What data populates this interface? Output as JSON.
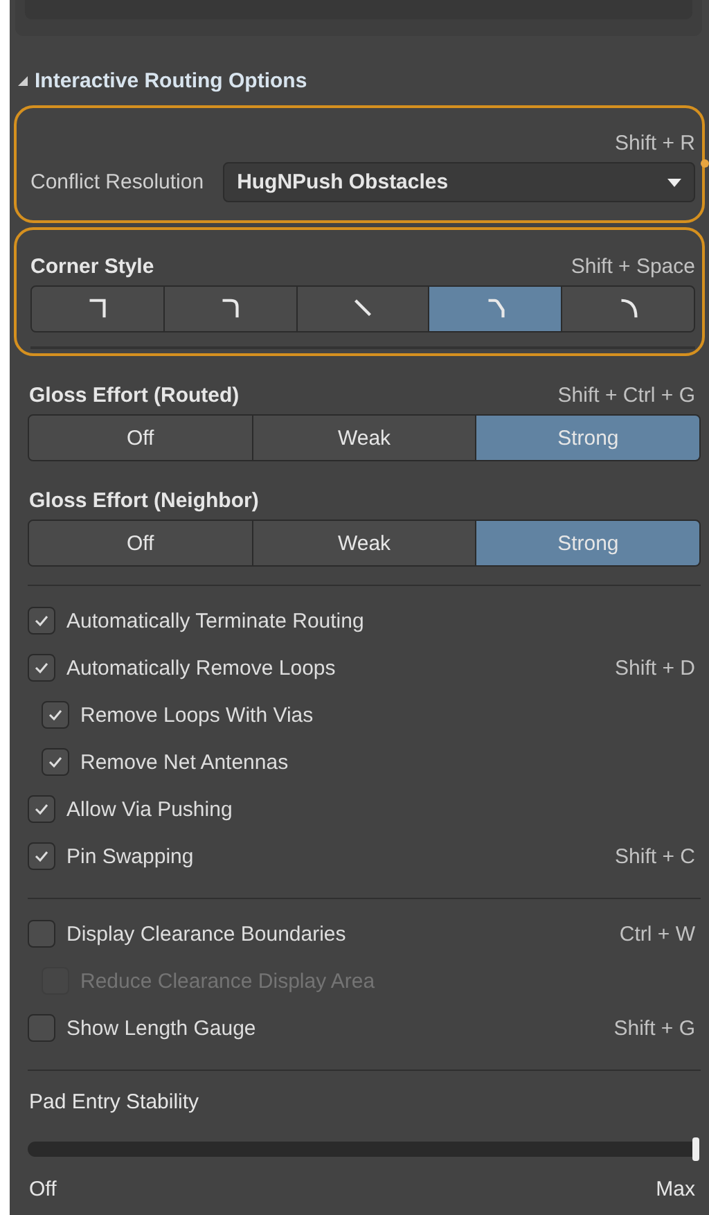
{
  "section": {
    "title": "Interactive Routing Options",
    "expanded": true
  },
  "conflict_resolution": {
    "highlighted": true,
    "shortcut": "Shift + R",
    "label": "Conflict Resolution",
    "value": "HugNPush Obstacles"
  },
  "corner_style": {
    "highlighted": true,
    "label": "Corner Style",
    "shortcut": "Shift + Space",
    "options": [
      {
        "kind": "right-angle",
        "selected": false
      },
      {
        "kind": "right-angle-arc",
        "selected": false
      },
      {
        "kind": "diagonal",
        "selected": false
      },
      {
        "kind": "diagonal-arc",
        "selected": true
      },
      {
        "kind": "arc",
        "selected": false
      }
    ]
  },
  "gloss_routed": {
    "label": "Gloss Effort (Routed)",
    "shortcut": "Shift + Ctrl + G",
    "options": [
      {
        "label": "Off",
        "selected": false
      },
      {
        "label": "Weak",
        "selected": false
      },
      {
        "label": "Strong",
        "selected": true
      }
    ]
  },
  "gloss_neighbor": {
    "label": "Gloss Effort (Neighbor)",
    "options": [
      {
        "label": "Off",
        "selected": false
      },
      {
        "label": "Weak",
        "selected": false
      },
      {
        "label": "Strong",
        "selected": true
      }
    ]
  },
  "options_group_1": [
    {
      "label": "Automatically Terminate Routing",
      "checked": true,
      "disabled": false
    },
    {
      "label": "Automatically Remove Loops",
      "checked": true,
      "disabled": false,
      "shortcut": "Shift + D",
      "children": [
        {
          "label": "Remove Loops With Vias",
          "checked": true,
          "disabled": false
        },
        {
          "label": "Remove Net Antennas",
          "checked": true,
          "disabled": false
        }
      ]
    },
    {
      "label": "Allow Via Pushing",
      "checked": true,
      "disabled": false
    },
    {
      "label": "Pin Swapping",
      "checked": true,
      "disabled": false,
      "shortcut": "Shift + C"
    }
  ],
  "options_group_2": [
    {
      "label": "Display Clearance Boundaries",
      "checked": false,
      "disabled": false,
      "shortcut": "Ctrl + W",
      "children": [
        {
          "label": "Reduce Clearance Display Area",
          "checked": false,
          "disabled": true
        }
      ]
    },
    {
      "label": "Show Length Gauge",
      "checked": false,
      "disabled": false,
      "shortcut": "Shift + G"
    }
  ],
  "pad_entry_stability": {
    "label": "Pad Entry Stability",
    "level": 1.0,
    "min_label": "Off",
    "max_label": "Max"
  }
}
